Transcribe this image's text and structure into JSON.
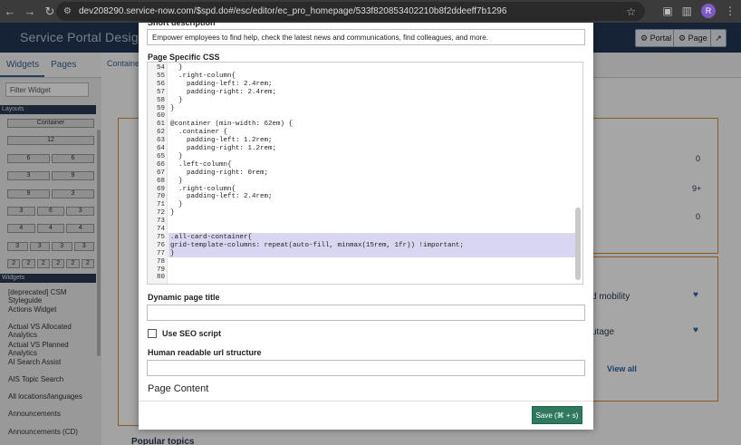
{
  "browser": {
    "url": "dev208290.service-now.com/$spd.do#/esc/editor/ec_pro_homepage/533f820853402210b8f2ddeeff7b1296",
    "avatar_letter": "R"
  },
  "app": {
    "title": "Service Portal Designer",
    "portal_button": "Portal",
    "page_button": "Page"
  },
  "sidebar": {
    "tabs": [
      "Widgets",
      "Pages"
    ],
    "filter_placeholder": "Filter Widget",
    "layouts_header": "Layouts",
    "layouts": [
      [
        "Container"
      ],
      [
        "12"
      ],
      [
        "6",
        "6"
      ],
      [
        "3",
        "9"
      ],
      [
        "9",
        "3"
      ],
      [
        "3",
        "6",
        "3"
      ],
      [
        "4",
        "4",
        "4"
      ],
      [
        "3",
        "3",
        "3",
        "3"
      ],
      [
        "2",
        "2",
        "2",
        "2",
        "2",
        "2"
      ]
    ],
    "widgets_header": "Widgets",
    "widgets": [
      "[deprecated] CSM Styleguide",
      "Actions Widget",
      "Actual VS Allocated Analytics",
      "Actual VS Planned Analytics",
      "AI Search Assist",
      "AIS Topic Search",
      "All locations/languages",
      "Announcements",
      "Announcements (CD)"
    ]
  },
  "canvas": {
    "container_tab": "Container",
    "popular_topics": "Popular topics",
    "mobility": "d mobility",
    "outage": "utage",
    "view_all": "View all",
    "counts": [
      "0",
      "9+",
      "0"
    ]
  },
  "modal": {
    "description_label": "Short description",
    "description_value": "Empower employees to find help, check the latest news and communications, find colleagues, and more.",
    "css_label": "Page Specific CSS",
    "line_numbers": [
      "54",
      "55",
      "56",
      "57",
      "58",
      "59",
      "60",
      "61",
      "62",
      "63",
      "64",
      "65",
      "66",
      "67",
      "68",
      "69",
      "70",
      "71",
      "72",
      "73",
      "74",
      "75",
      "76",
      "77",
      "78",
      "79",
      "80"
    ],
    "code_lines": [
      "  }",
      "  .right-column{",
      "    padding-left: 2.4rem;",
      "    padding-right: 2.4rem;",
      "  }",
      "}",
      "",
      "@container (min-width: 62em) {",
      "  .container {",
      "    padding-left: 1.2rem;",
      "    padding-right: 1.2rem;",
      "  }",
      "  .left-column{",
      "    padding-right: 0rem;",
      "  }",
      "  .right-column{",
      "    padding-left: 2.4rem;",
      "  }",
      "}",
      "",
      "",
      ".all-card-container{",
      "grid-template-columns: repeat(auto-fill, minmax(15rem, 1fr)) !important;",
      "}",
      "",
      "",
      ""
    ],
    "dynamic_title_label": "Dynamic page title",
    "seo_label": "Use SEO script",
    "url_structure_label": "Human readable url structure",
    "page_content_label": "Page Content",
    "save_button": "Save  (⌘ + s)"
  }
}
